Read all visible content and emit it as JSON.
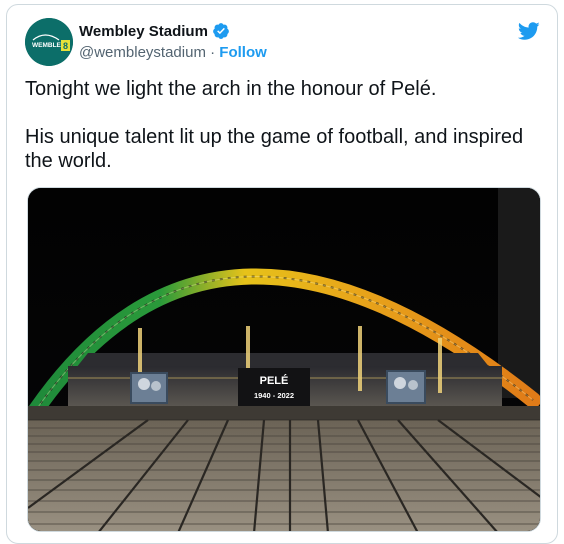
{
  "tweet": {
    "display_name": "Wembley Stadium",
    "handle": "@wembleystadium",
    "separator": " · ",
    "follow_label": "Follow",
    "text": "Tonight we light the arch in the honour of Pelé.\n\nHis unique talent lit up the game of football, and inspired the world."
  },
  "avatar": {
    "logo_text": "WEMBLEY",
    "badge_text": "8"
  },
  "media": {
    "screen_title": "PELÉ",
    "screen_years": "1940 - 2022",
    "arch_colors": [
      "#1f8a3a",
      "#e6c21a",
      "#e07b18"
    ]
  },
  "icons": {
    "verified": "verified-badge-icon",
    "platform": "twitter-bird-icon"
  },
  "colors": {
    "accent": "#1d9bf0",
    "text": "#0f1419",
    "muted": "#536471"
  }
}
